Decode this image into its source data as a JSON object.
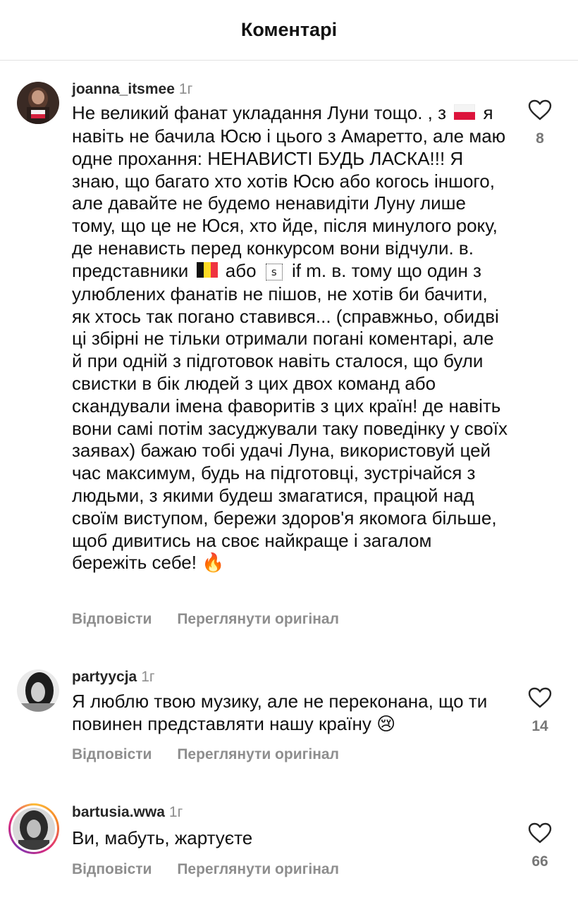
{
  "header": {
    "title": "Коментарі"
  },
  "actions": {
    "reply_label": "Відповісти",
    "view_original_label": "Переглянути оригінал"
  },
  "colors": {
    "accent_like": "#262626",
    "secondary_text": "#8e8e8e",
    "divider": "#e2e2e2"
  },
  "comments": [
    {
      "username": "joanna_itsmee",
      "time": "1г",
      "likes": "8",
      "text_parts": [
        "Не великий фанат укладання Луни тощо. , з",
        "я навіть не бачила Юсю і цього з Амаретто, але маю одне прохання: НЕНАВИСТІ БУДЬ ЛАСКА!!! Я знаю, що багато хто хотів Юсю або когось іншого, але давайте не будемо ненавидіти Луну лише тому, що це не Юся, хто йде, після минулого року, де ненависть перед конкурсом вони відчули. в. представники",
        "або",
        "if m. в. тому що один з улюблених фанатів не пішов, не хотів би бачити, як хтось так погано ставився... (справжньо, обидві ці збірні не тільки отримали погані коментарі, але й при одній з підготовок навіть сталося, що були свистки в бік людей з цих двох команд або скандували імена фаворитів з цих країн! де навіть вони самі потім засуджували таку поведінку у своїх заявах) бажаю тобі удачі Луна, використовуй цей час максимум, будь на підготовці, зустрічайся з людьми, з якими будеш змагатися, працюй над своїм виступом, бережи здоров'я якомога більше, щоб дивитись на своє найкраще і загалом бережіть себе!"
      ],
      "glyph": "s",
      "emoji_end": "🔥"
    },
    {
      "username": "partyycja",
      "time": "1г",
      "likes": "14",
      "text": "Я люблю твою музику, але не переконана, що ти повинен представляти нашу країну",
      "emoji_end": "😢"
    },
    {
      "username": "bartusia.wwa",
      "time": "1г",
      "likes": "66",
      "text": "Ви, мабуть, жартуєте"
    }
  ]
}
